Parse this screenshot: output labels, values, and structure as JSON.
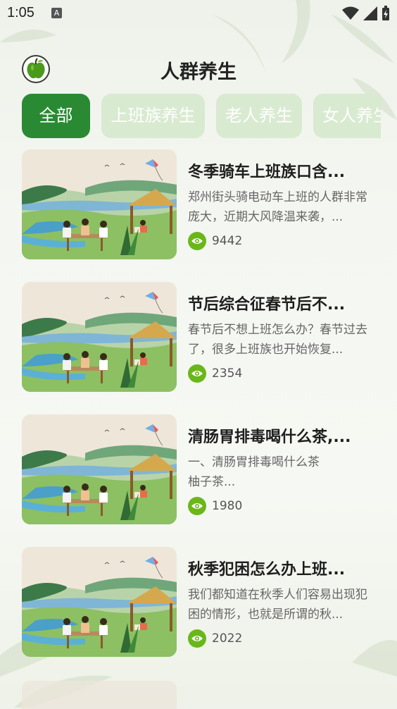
{
  "status_bar": {
    "time": "1:05",
    "indicator": "A",
    "icons": [
      "wifi-icon",
      "cell-signal-icon",
      "battery-charging-icon"
    ]
  },
  "header": {
    "title": "人群养生",
    "logo_icon": "apple-icon"
  },
  "tabs": [
    {
      "label": "全部",
      "active": true
    },
    {
      "label": "上班族养生",
      "active": false
    },
    {
      "label": "老人养生",
      "active": false
    },
    {
      "label": "女人养生",
      "active": false
    }
  ],
  "articles": [
    {
      "title": "冬季骑车上班族口含...",
      "desc": "郑州街头骑电动车上班的人群非常庞大，近期大风降温来袭，...",
      "views": "9442"
    },
    {
      "title": "节后综合征春节后不...",
      "desc": "春节后不想上班怎么办？春节过去了，很多上班族也开始恢复...",
      "views": "2354"
    },
    {
      "title": "清肠胃排毒喝什么茶,...",
      "desc": "一、清肠胃排毒喝什么茶\n柚子茶...",
      "views": "1980"
    },
    {
      "title": "秋季犯困怎么办上班...",
      "desc": "我们都知道在秋季人们容易出现犯困的情形，也就是所谓的秋...",
      "views": "2022"
    }
  ],
  "colors": {
    "accent": "#2a8a33",
    "tab_inactive": "#d8ead0",
    "eye": "#6ab71a"
  }
}
